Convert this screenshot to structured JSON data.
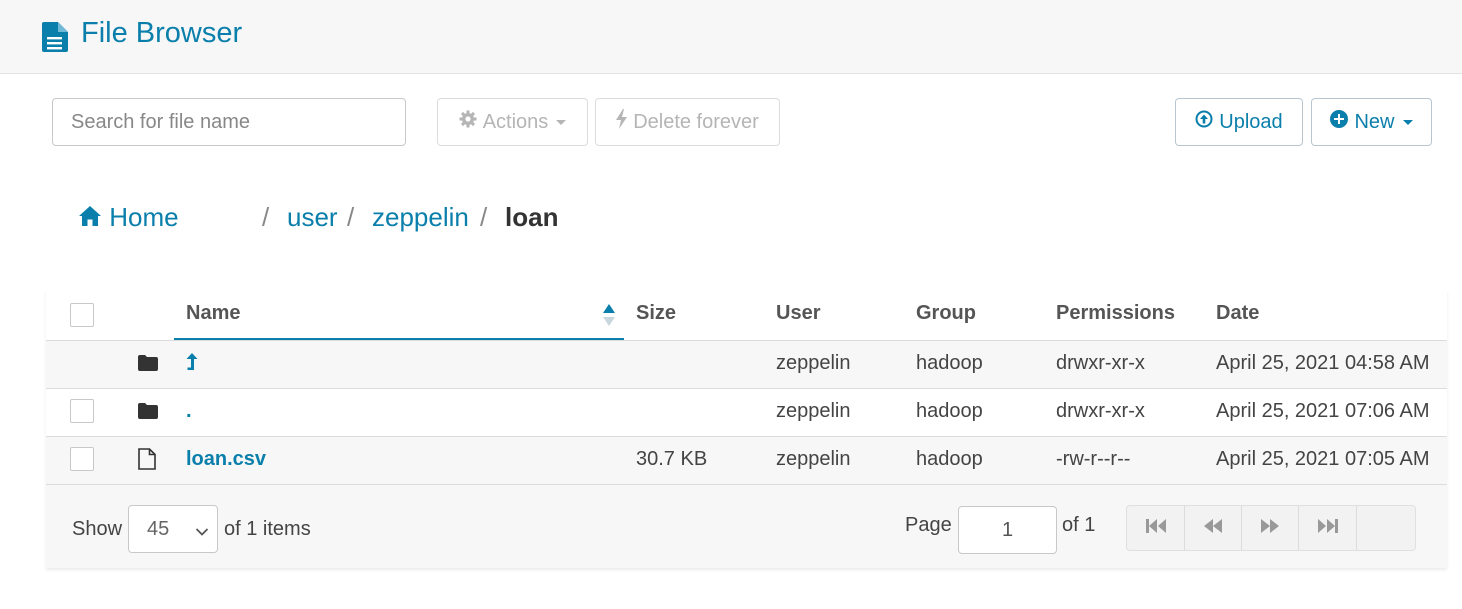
{
  "header": {
    "title": "File Browser",
    "icon": "file-text-icon"
  },
  "toolbar": {
    "search_placeholder": "Search for file name",
    "actions_label": "Actions",
    "delete_label": "Delete forever",
    "upload_label": "Upload",
    "new_label": "New"
  },
  "breadcrumb": {
    "home": "Home",
    "separators": [
      "/",
      "/",
      "/"
    ],
    "parts": [
      "user",
      "zeppelin"
    ],
    "current": "loan"
  },
  "table": {
    "columns": [
      "Name",
      "Size",
      "User",
      "Group",
      "Permissions",
      "Date"
    ],
    "sort": {
      "column": "Name",
      "direction": "ascending"
    },
    "rows": [
      {
        "type": "parent-folder",
        "name": "",
        "size": "",
        "user": "zeppelin",
        "group": "hadoop",
        "permissions": "drwxr-xr-x",
        "date": "April 25, 2021 04:58 AM"
      },
      {
        "type": "folder",
        "name": ".",
        "size": "",
        "user": "zeppelin",
        "group": "hadoop",
        "permissions": "drwxr-xr-x",
        "date": "April 25, 2021 07:06 AM"
      },
      {
        "type": "file",
        "name": "loan.csv",
        "size": "30.7 KB",
        "user": "zeppelin",
        "group": "hadoop",
        "permissions": "-rw-r--r--",
        "date": "April 25, 2021 07:05 AM"
      }
    ]
  },
  "footer": {
    "show_label": "Show",
    "page_size": "45",
    "items_label": "of 1 items",
    "page_label": "Page",
    "current_page": "1",
    "of_pages": "of 1"
  },
  "colors": {
    "accent": "#0b7fab",
    "header_bg": "#f7f7f7",
    "row_shade": "#f7f7f7"
  }
}
